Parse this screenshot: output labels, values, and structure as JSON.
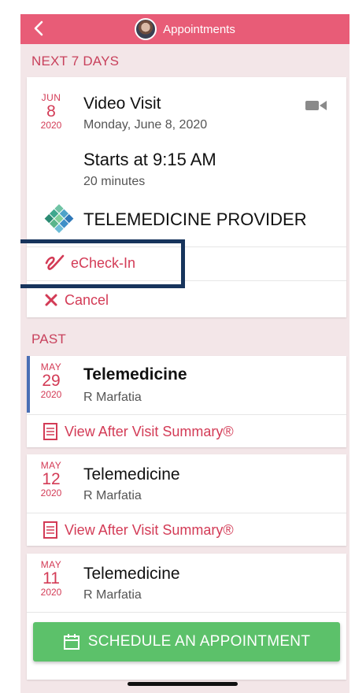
{
  "header": {
    "title": "Appointments"
  },
  "sections": {
    "upcoming": "NEXT 7 DAYS",
    "past": "PAST"
  },
  "upcoming": {
    "month": "JUN",
    "day": "8",
    "year": "2020",
    "title": "Video Visit",
    "date_text": "Monday, June 8, 2020",
    "starts": "Starts at 9:15 AM",
    "duration": "20 minutes",
    "provider": "TELEMEDICINE PROVIDER",
    "echeckin_label": "eCheck-In",
    "cancel_label": "Cancel"
  },
  "past": [
    {
      "month": "MAY",
      "day": "29",
      "year": "2020",
      "title": "Telemedicine",
      "provider": "R Marfatia",
      "summary_label": "View After Visit Summary®"
    },
    {
      "month": "MAY",
      "day": "12",
      "year": "2020",
      "title": "Telemedicine",
      "provider": "R Marfatia",
      "summary_label": "View After Visit Summary®"
    },
    {
      "month": "MAY",
      "day": "11",
      "year": "2020",
      "title": "Telemedicine",
      "provider": "R Marfatia"
    }
  ],
  "schedule_button": "SCHEDULE AN APPOINTMENT",
  "colors": {
    "header": "#e85c77",
    "accent": "#d33b56",
    "button": "#5cc16a",
    "highlight": "#17345c"
  },
  "icons": [
    "back-chevron-icon",
    "video-camera-icon",
    "provider-logo-icon",
    "echeckin-icon",
    "cancel-x-icon",
    "document-icon",
    "calendar-icon"
  ]
}
